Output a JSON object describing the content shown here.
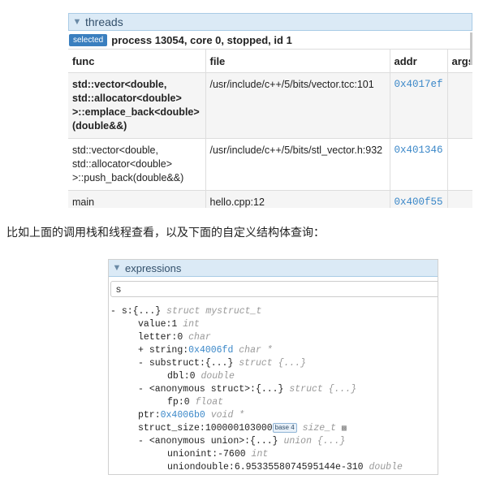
{
  "threads": {
    "title": "threads",
    "badge": "selected",
    "process_text": "process 13054, core 0, stopped, id 1",
    "columns": [
      "func",
      "file",
      "addr",
      "args"
    ],
    "rows": [
      {
        "func": "std::vector<double, std::allocator<double> >::emplace_back<double> (double&&)",
        "file": "/usr/include/c++/5/bits/vector.tcc:101",
        "addr": "0x4017ef",
        "args": ""
      },
      {
        "func": "std::vector<double, std::allocator<double> >::push_back(double&&)",
        "file": "/usr/include/c++/5/bits/stl_vector.h:932",
        "addr": "0x401346",
        "args": ""
      },
      {
        "func": "main",
        "file": "hello.cpp:12",
        "addr": "0x400f55",
        "args": ""
      }
    ]
  },
  "caption": "比如上面的调用栈和线程查看，以及下面的自定义结构体查询：",
  "expressions": {
    "title": "expressions",
    "search_value": "s",
    "tree": [
      {
        "prefix": "- ",
        "name": "s",
        "value": "{...}",
        "type": "struct mystruct_t"
      },
      {
        "prefix": "",
        "name": "value",
        "value": "1",
        "type": "int"
      },
      {
        "prefix": "",
        "name": "letter",
        "value": "0",
        "type": "char"
      },
      {
        "prefix": "+ ",
        "name": "string",
        "value": "0x4006fd",
        "type": "char *"
      },
      {
        "prefix": "- ",
        "name": "substruct",
        "value": "{...}",
        "type": "struct {...}"
      },
      {
        "prefix": "",
        "name": "dbl",
        "value": "0",
        "type": "double"
      },
      {
        "prefix": "- ",
        "name": "<anonymous struct>",
        "value": "{...}",
        "type": "struct {...}"
      },
      {
        "prefix": "",
        "name": "fp",
        "value": "0",
        "type": "float"
      },
      {
        "prefix": "",
        "name": "ptr",
        "value": "0x4006b0",
        "type": "void *"
      },
      {
        "prefix": "",
        "name": "struct_size",
        "value": "100000103000",
        "badge": "base 4",
        "type": "size_t"
      },
      {
        "prefix": "- ",
        "name": "<anonymous union>",
        "value": "{...}",
        "type": "union {...}"
      },
      {
        "prefix": "",
        "name": "unionint",
        "value": "-7600",
        "type": "int"
      },
      {
        "prefix": "",
        "name": "uniondouble",
        "value": "6.9533558074595144e-310",
        "type": "double"
      }
    ]
  },
  "colors": {
    "accent": "#3a7fbf",
    "hex_value": "#3a87c8",
    "header_bg": "#dbeaf6"
  }
}
